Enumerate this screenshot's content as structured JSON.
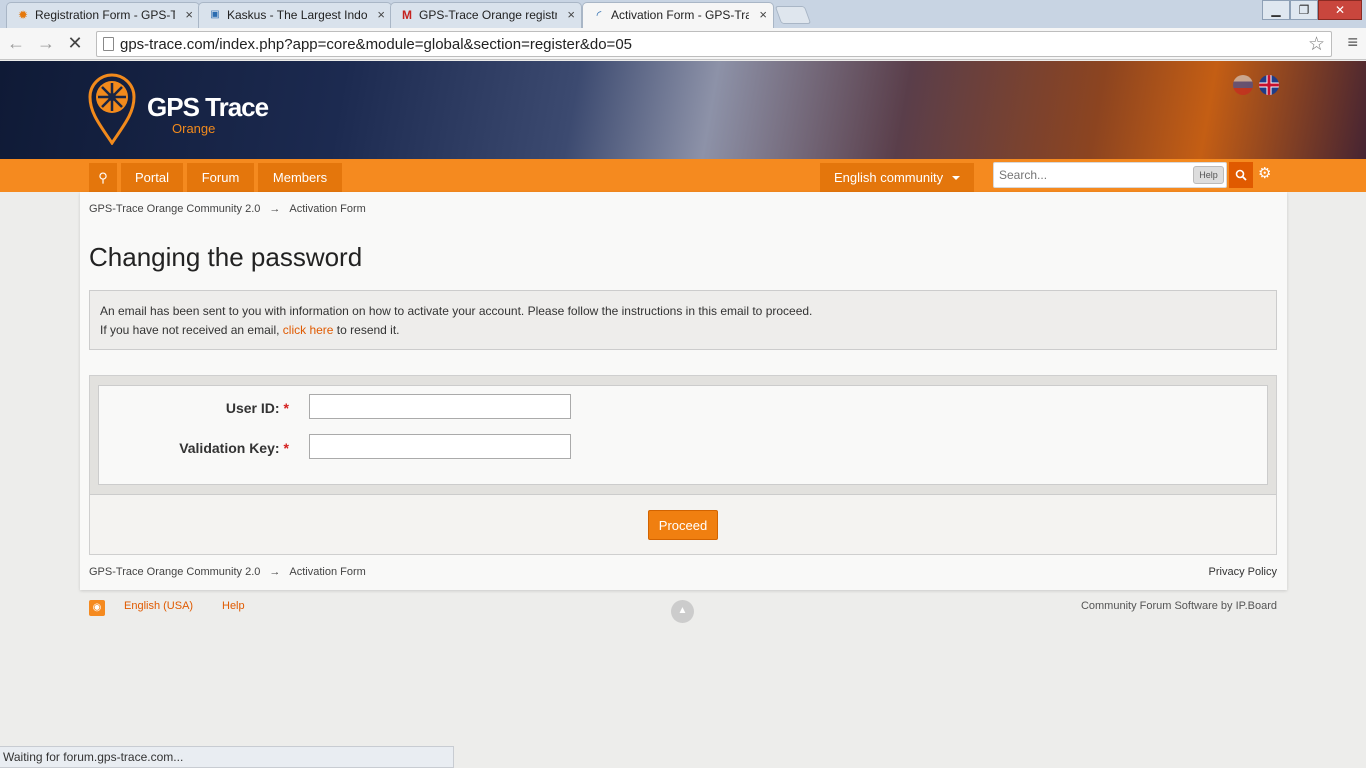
{
  "browser": {
    "tabs": [
      {
        "title": "Registration Form - GPS-Trace",
        "favicon": "gps-trace-icon",
        "active": false
      },
      {
        "title": "Kaskus - The Largest Indonesian",
        "favicon": "kaskus-icon",
        "active": false
      },
      {
        "title": "GPS-Trace Orange registration",
        "favicon": "gmail-icon",
        "active": false
      },
      {
        "title": "Activation Form - GPS-Trace",
        "favicon": "loading-spinner-icon",
        "active": true
      }
    ],
    "url": "gps-trace.com/index.php?app=core&module=global&section=register&do=05",
    "status": "Waiting for forum.gps-trace.com..."
  },
  "site": {
    "logo_title": "GPS Trace",
    "logo_subtitle": "Orange",
    "nav": {
      "items": [
        "Portal",
        "Forum",
        "Members"
      ],
      "community": "English community",
      "search_placeholder": "Search...",
      "search_help": "Help"
    }
  },
  "breadcrumb": {
    "root": "GPS-Trace Orange Community 2.0",
    "arrow": "→",
    "current": "Activation Form"
  },
  "main": {
    "title": "Changing the password",
    "message": {
      "line1": "An email has been sent to you with information on how to activate your account. Please follow the instructions in this email to proceed.",
      "line2_before": "If you have not received an email, ",
      "line2_link": "click here",
      "line2_after": " to resend it."
    },
    "form": {
      "user_id_label": "User ID:",
      "validation_key_label": "Validation Key:",
      "required_marker": "*",
      "user_id_value": "",
      "validation_key_value": "",
      "submit_label": "Proceed"
    }
  },
  "footer": {
    "privacy": "Privacy Policy",
    "language": "English (USA)",
    "help": "Help",
    "powered_by": "Community Forum Software by IP.Board"
  },
  "colors": {
    "accent": "#f58a1f",
    "accent_dark": "#e4760c",
    "link": "#e05a00"
  }
}
